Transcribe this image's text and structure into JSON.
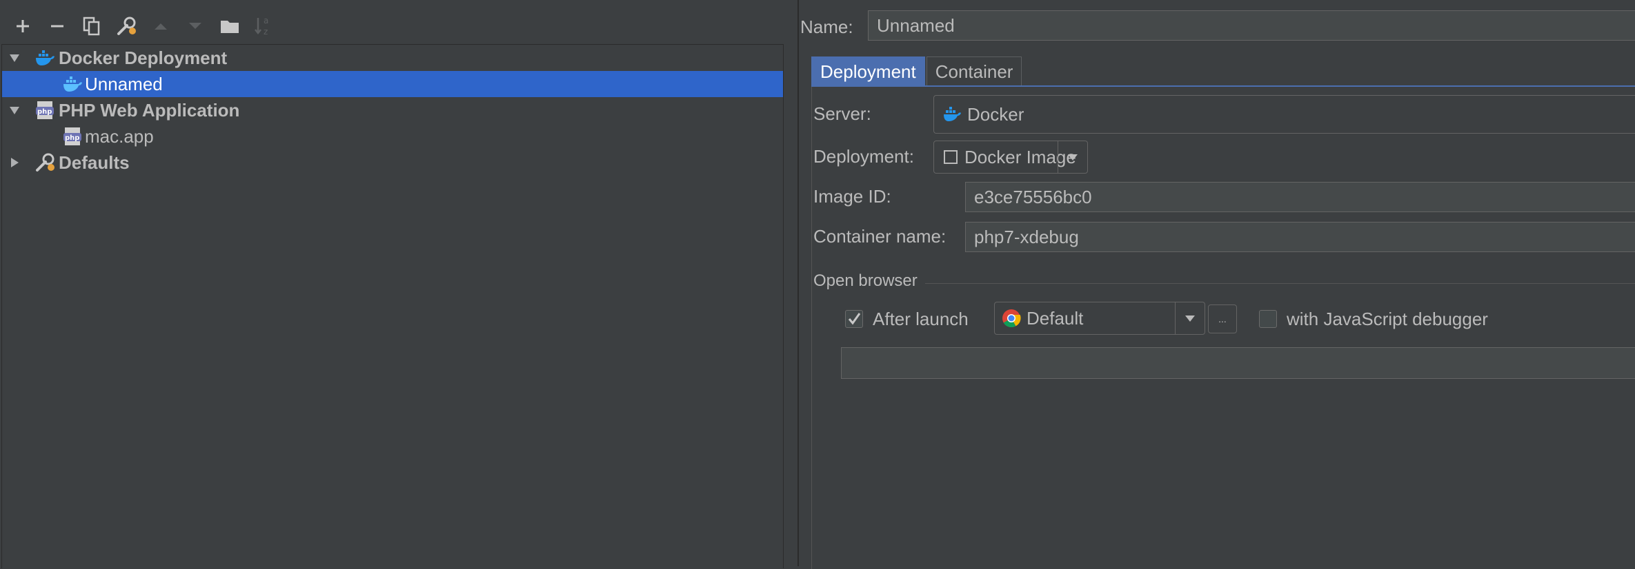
{
  "toolbar": {
    "buttons": [
      {
        "name": "add",
        "icon": "plus-icon"
      },
      {
        "name": "remove",
        "icon": "minus-icon"
      },
      {
        "name": "copy",
        "icon": "copy-icon"
      },
      {
        "name": "edit-defaults",
        "icon": "wrench-icon"
      },
      {
        "name": "move-up",
        "icon": "arrow-up-icon",
        "disabled": true
      },
      {
        "name": "move-down",
        "icon": "arrow-down-icon",
        "disabled": true
      },
      {
        "name": "new-folder",
        "icon": "folder-icon"
      },
      {
        "name": "sort",
        "icon": "sort-alpha-icon",
        "disabled": true
      }
    ]
  },
  "tree": {
    "docker_group": "Docker Deployment",
    "docker_item": "Unnamed",
    "php_group": "PHP Web Application",
    "php_item": "mac.app",
    "defaults_group": "Defaults"
  },
  "form": {
    "name_label": "Name:",
    "name_value": "Unnamed",
    "tabs": [
      "Deployment",
      "Container"
    ],
    "active_tab": "Deployment",
    "server_label": "Server:",
    "server_value": "Docker",
    "deployment_label": "Deployment:",
    "deployment_value": "Docker Image",
    "image_id_label": "Image ID:",
    "image_id_value": "e3ce75556bc0",
    "container_name_label": "Container name:",
    "container_name_value": "php7-xdebug",
    "open_browser_label": "Open browser",
    "after_launch_label": "After launch",
    "after_launch_checked": true,
    "browser_value": "Default",
    "browse_button_label": "...",
    "js_debugger_label": "with JavaScript debugger",
    "js_debugger_checked": false,
    "url_value": ""
  },
  "colors": {
    "background": "#3c3f41",
    "selection": "#2f65ca",
    "active_tab": "#4b6eaf",
    "docker_blue": "#2496ed",
    "text": "#bbbbbb"
  }
}
